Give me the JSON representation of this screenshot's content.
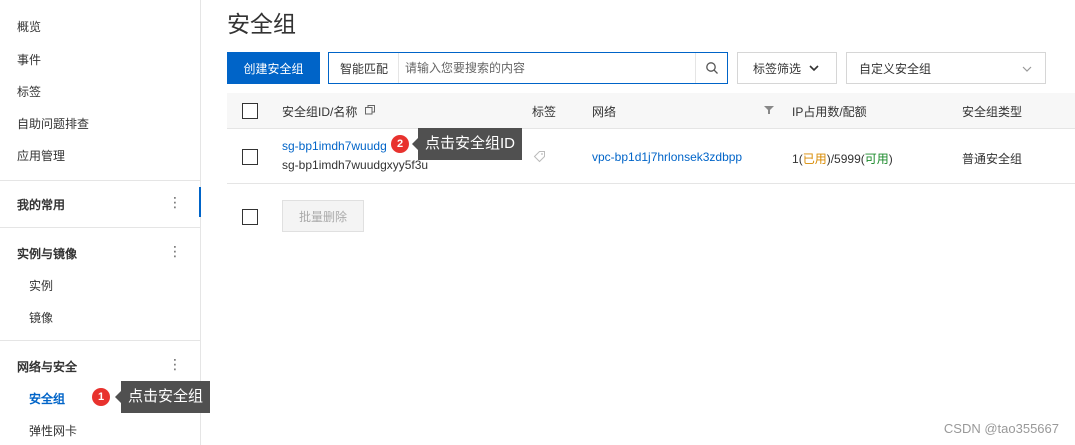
{
  "sidebar": {
    "top_items": [
      "概览",
      "事件",
      "标签",
      "自助问题排查",
      "应用管理"
    ],
    "favorites": "我的常用",
    "group_instances": "实例与镜像",
    "instances_sub": [
      "实例",
      "镜像"
    ],
    "group_network": "网络与安全",
    "network_sub": [
      "安全组",
      "弹性网卡"
    ]
  },
  "main": {
    "title": "安全组",
    "create_button": "创建安全组",
    "search": {
      "mode": "智能匹配",
      "placeholder": "请输入您要搜索的内容"
    },
    "tag_filter": "标签筛选",
    "custom_select": "自定义安全组"
  },
  "table": {
    "headers": [
      "安全组ID/名称",
      "标签",
      "网络",
      "IP占用数/配额",
      "安全组类型"
    ],
    "rows": [
      {
        "id": "sg-bp1imdh7wuudg",
        "name": "sg-bp1imdh7wuudgxyy5f3u",
        "network": "vpc-bp1d1j7hrlonsek3zdbpp",
        "ip_used": "1",
        "used_label": "已用",
        "ip_quota": "5999",
        "available_label": "可用",
        "type": "普通安全组"
      }
    ],
    "batch_delete": "批量删除"
  },
  "annotations": [
    {
      "num": "1",
      "text": "点击安全组"
    },
    {
      "num": "2",
      "text": "点击安全组ID"
    }
  ],
  "watermark": "CSDN @tao355667",
  "colors": {
    "accent": "#0064c8",
    "badge": "#e8322e",
    "tooltip": "#505050"
  }
}
